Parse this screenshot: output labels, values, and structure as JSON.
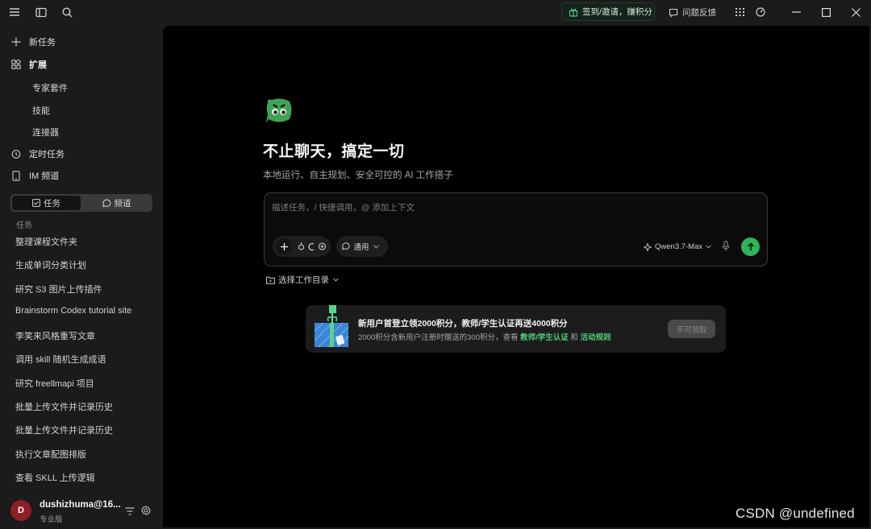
{
  "titlebar": {
    "promo_text": "签到/邀请，赚积分",
    "feedback_label": "问题反馈"
  },
  "sidebar": {
    "new_task": "新任务",
    "extensions": "扩展",
    "expert_suite": "专家套件",
    "skills": "技能",
    "connectors": "连接器",
    "scheduled_tasks": "定时任务",
    "im_channel": "IM 频道",
    "tab_tasks": "任务",
    "tab_channels": "频道",
    "section_label": "任务",
    "tasks": [
      "整理课程文件夹",
      "生成单词分类计划",
      "研究 S3 图片上传插件",
      "Brainstorm Codex tutorial site",
      "李笑来风格重写文章",
      "调用 skill 随机生成成语",
      "研究 freellmapi 项目",
      "批量上传文件并记录历史",
      "批量上传文件并记录历史",
      "执行文章配图排版",
      "查看 SKLL 上传逻辑"
    ],
    "user": {
      "avatar_letter": "D",
      "name": "dushizhuma@16...",
      "plan": "专业版"
    }
  },
  "main": {
    "title": "不止聊天，搞定一切",
    "subtitle": "本地运行、自主规划、安全可控的 AI 工作搭子",
    "composer": {
      "placeholder": "描述任务，/ 快捷调用，@ 添加上下文",
      "mode_label": "通用",
      "model_label": "Qwen3.7-Max"
    },
    "workdir_label": "选择工作目录",
    "promo": {
      "title": "新用户首登立领2000积分，教师/学生认证再送4000积分",
      "desc_prefix": "2000积分含新用户注册时赠送的300积分，查看 ",
      "link1": "教师/学生认证",
      "desc_and": " 和 ",
      "link2": "活动规则",
      "button": "不可领取"
    }
  },
  "watermark": "CSDN @undefined",
  "colors": {
    "accent_green": "#2fb45a",
    "avatar_red": "#8f1e26",
    "main_bg": "#000000",
    "sidebar_bg": "#1b1b1b"
  }
}
